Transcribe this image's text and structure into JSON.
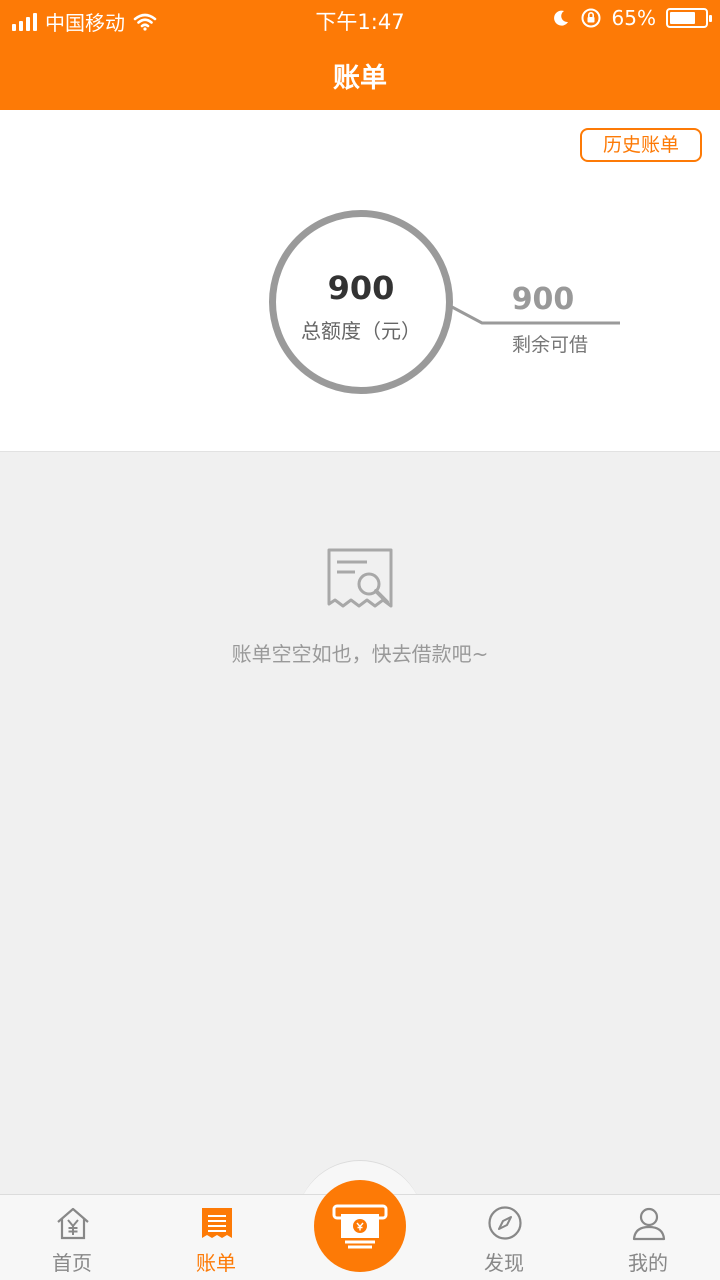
{
  "status_bar": {
    "carrier": "中国移动",
    "time": "下午1:47",
    "battery": "65%"
  },
  "header": {
    "title": "账单"
  },
  "summary": {
    "history_button": "历史账单",
    "total_amount": "900",
    "total_label": "总额度（元）",
    "remaining_amount": "900",
    "remaining_label": "剩余可借"
  },
  "empty_state": {
    "message": "账单空空如也，快去借款吧~"
  },
  "tabbar": {
    "items": [
      {
        "label": "首页",
        "icon": "home-yen-icon"
      },
      {
        "label": "账单",
        "icon": "bill-icon"
      },
      {
        "label": "发现",
        "icon": "compass-icon"
      },
      {
        "label": "我的",
        "icon": "user-icon"
      }
    ],
    "center_icon": "cash-icon",
    "active_index": 1
  },
  "colors": {
    "brand": "#fd7a06",
    "ring": "#9a9a9a",
    "muted_text": "#999999"
  }
}
